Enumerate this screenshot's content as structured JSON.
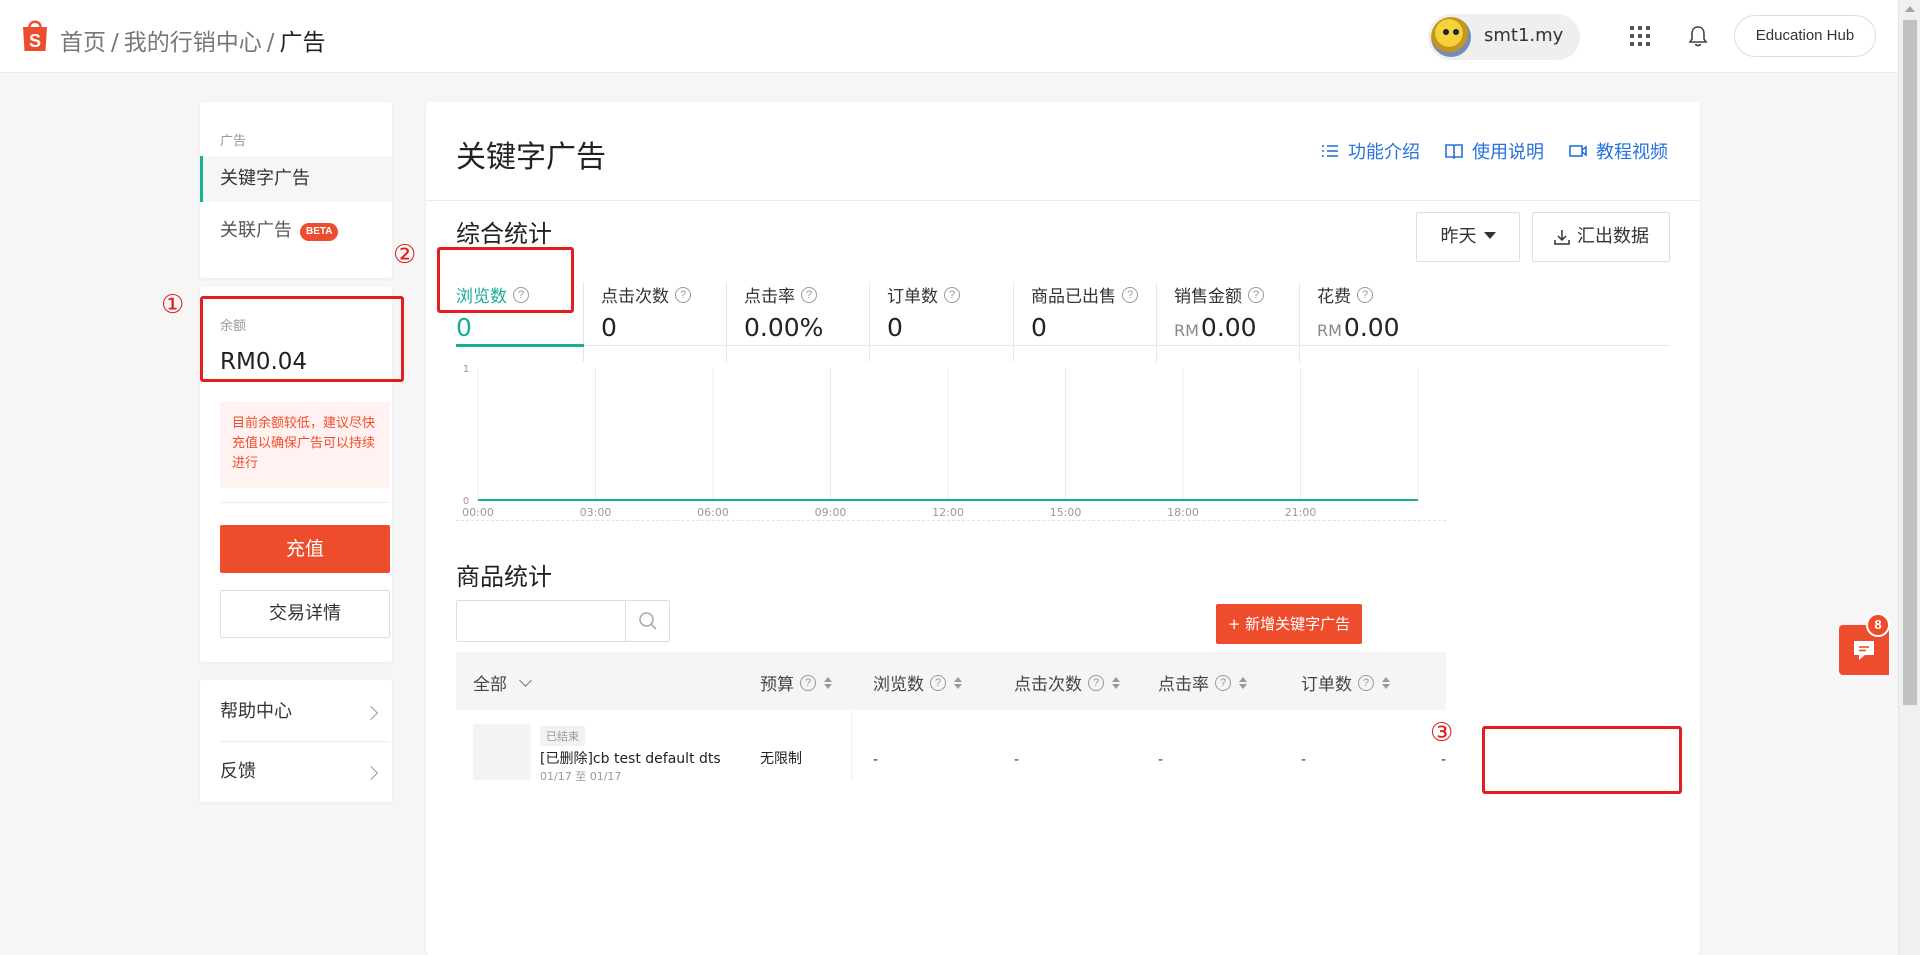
{
  "header": {
    "breadcrumb": {
      "home": "首页",
      "marketing": "我的行销中心",
      "current": "广告",
      "separator": "/"
    },
    "user_name": "smt1.my",
    "education_hub": "Education Hub"
  },
  "sidebar": {
    "nav_heading": "广告",
    "items": [
      {
        "label": "关键字广告",
        "active": true
      },
      {
        "label": "关联广告",
        "badge": "BETA"
      }
    ],
    "balance": {
      "label": "余额",
      "value": "RM0.04",
      "warning": "目前余额较低，建议尽快充值以确保广告可以持续进行",
      "recharge": "充值",
      "transactions": "交易详情"
    },
    "help": [
      {
        "label": "帮助中心"
      },
      {
        "label": "反馈"
      }
    ]
  },
  "main": {
    "title": "关键字广告",
    "links": [
      {
        "label": "功能介绍",
        "icon": "list-icon"
      },
      {
        "label": "使用说明",
        "icon": "book-icon"
      },
      {
        "label": "教程视频",
        "icon": "video-icon"
      }
    ],
    "overview_title": "综合统计",
    "period": "昨天",
    "export": "汇出数据",
    "metrics": [
      {
        "label": "浏览数",
        "value": "0",
        "active": true
      },
      {
        "label": "点击次数",
        "value": "0"
      },
      {
        "label": "点击率",
        "value": "0.00%"
      },
      {
        "label": "订单数",
        "value": "0"
      },
      {
        "label": "商品已出售",
        "value": "0"
      },
      {
        "label": "销售金额",
        "unit": "RM",
        "value": "0.00"
      },
      {
        "label": "花费",
        "unit": "RM",
        "value": "0.00"
      }
    ],
    "product_title": "商品统计",
    "search_placeholder": "",
    "add_button": "+ 新增关键字广告",
    "table": {
      "columns": [
        "全部",
        "预算",
        "浏览数",
        "点击次数",
        "点击率",
        "订单数"
      ],
      "rows": [
        {
          "status": "已结束",
          "name": "[已删除]cb test default dts",
          "date": "01/17 至 01/17",
          "budget": "无限制",
          "cells": [
            "-",
            "-",
            "-",
            "-",
            "-"
          ]
        }
      ]
    }
  },
  "chart_data": {
    "type": "line",
    "x": [
      "00:00",
      "03:00",
      "06:00",
      "09:00",
      "12:00",
      "15:00",
      "18:00",
      "21:00"
    ],
    "y_ticks": [
      0,
      1
    ],
    "ylim": [
      0,
      1
    ],
    "series": [
      {
        "values": [
          0,
          0,
          0,
          0,
          0,
          0,
          0,
          0,
          0
        ],
        "color": "#1aad95"
      }
    ],
    "grid": true
  },
  "annotations": [
    "①",
    "②",
    "③"
  ],
  "chat_badge": "8",
  "colors": {
    "brand": "#ee4d2d",
    "accent": "#1aad95",
    "link": "#2673dd"
  }
}
